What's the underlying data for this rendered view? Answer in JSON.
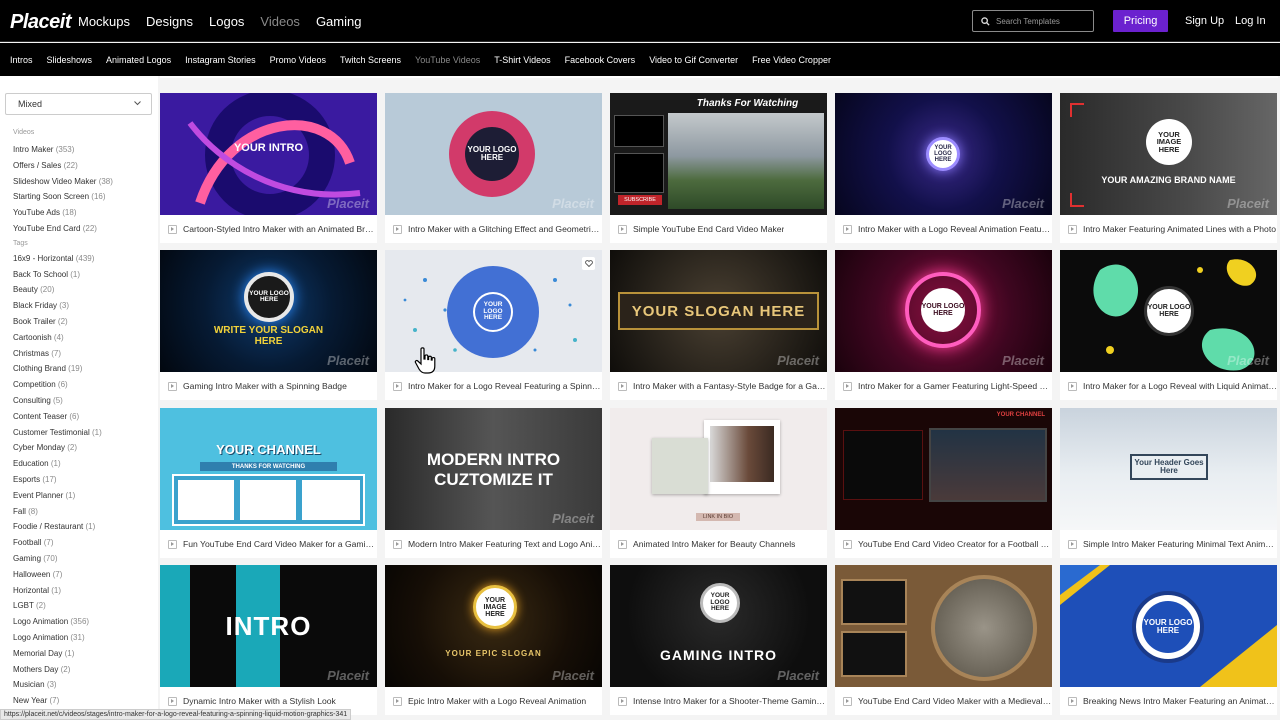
{
  "header": {
    "logo": "Placeit",
    "nav": [
      "Mockups",
      "Designs",
      "Logos",
      "Videos",
      "Gaming"
    ],
    "active_nav": "Videos",
    "search_placeholder": "Search Templates",
    "pricing": "Pricing",
    "sign_up": "Sign Up",
    "log_in": "Log In"
  },
  "subnav": [
    "Intros",
    "Slideshows",
    "Animated Logos",
    "Instagram Stories",
    "Promo Videos",
    "Twitch Screens",
    "YouTube Videos",
    "T-Shirt Videos",
    "Facebook Covers",
    "Video to Gif Converter",
    "Free Video Cropper"
  ],
  "active_subnav": "YouTube Videos",
  "sidebar": {
    "sort": "Mixed",
    "videos_heading": "Videos",
    "videos": [
      {
        "label": "Intro Maker",
        "count": "(353)"
      },
      {
        "label": "Offers / Sales",
        "count": "(22)"
      },
      {
        "label": "Slideshow Video Maker",
        "count": "(38)"
      },
      {
        "label": "Starting Soon Screen",
        "count": "(16)"
      },
      {
        "label": "YouTube Ads",
        "count": "(18)"
      },
      {
        "label": "YouTube End Card",
        "count": "(22)"
      }
    ],
    "tags_heading": "Tags",
    "tags": [
      {
        "label": "16x9 - Horizontal",
        "count": "(439)"
      },
      {
        "label": "Back To School",
        "count": "(1)"
      },
      {
        "label": "Beauty",
        "count": "(20)"
      },
      {
        "label": "Black Friday",
        "count": "(3)"
      },
      {
        "label": "Book Trailer",
        "count": "(2)"
      },
      {
        "label": "Cartoonish",
        "count": "(4)"
      },
      {
        "label": "Christmas",
        "count": "(7)"
      },
      {
        "label": "Clothing Brand",
        "count": "(19)"
      },
      {
        "label": "Competition",
        "count": "(6)"
      },
      {
        "label": "Consulting",
        "count": "(5)"
      },
      {
        "label": "Content Teaser",
        "count": "(6)"
      },
      {
        "label": "Customer Testimonial",
        "count": "(1)"
      },
      {
        "label": "Cyber Monday",
        "count": "(2)"
      },
      {
        "label": "Education",
        "count": "(1)"
      },
      {
        "label": "Esports",
        "count": "(17)"
      },
      {
        "label": "Event Planner",
        "count": "(1)"
      },
      {
        "label": "Fall",
        "count": "(8)"
      },
      {
        "label": "Foodie / Restaurant",
        "count": "(1)"
      },
      {
        "label": "Football",
        "count": "(7)"
      },
      {
        "label": "Gaming",
        "count": "(70)"
      },
      {
        "label": "Halloween",
        "count": "(7)"
      },
      {
        "label": "Horizontal",
        "count": "(1)"
      },
      {
        "label": "LGBT",
        "count": "(2)"
      },
      {
        "label": "Logo Animation",
        "count": "(356)"
      },
      {
        "label": "Logo Animation",
        "count": "(31)"
      },
      {
        "label": "Memorial Day",
        "count": "(1)"
      },
      {
        "label": "Mothers Day",
        "count": "(2)"
      },
      {
        "label": "Musician",
        "count": "(3)"
      },
      {
        "label": "New Year",
        "count": "(7)"
      }
    ]
  },
  "thumb_text": {
    "your_intro": "YOUR INTRO",
    "your_logo_here": "YOUR LOGO HERE",
    "your_image_here": "YOUR IMAGE HERE",
    "thanks_for_watching": "Thanks For Watching",
    "subscribe": "SUBSCRIBE",
    "brand_name": "YOUR AMAZING BRAND NAME",
    "write_slogan": "WRITE YOUR SLOGAN HERE",
    "slogan_here": "YOUR SLOGAN HERE",
    "your_channel": "YOUR CHANNEL",
    "thanks_watching_caps": "THANKS FOR WATCHING",
    "modern_intro": "MODERN INTRO",
    "cuztomize": "CUZTOMIZE IT",
    "link_in_bio": "LINK IN BIO",
    "header_goes_here": "Your Header Goes Here",
    "intro": "INTRO",
    "epic_slogan": "YOUR EPIC SLOGAN",
    "gaming_intro": "GAMING INTRO",
    "watermark": "Placeit"
  },
  "cards": [
    "Cartoon-Styled Intro Maker with an Animated Brush Stroke",
    "Intro Maker with a Glitching Effect and Geometric Shapes",
    "Simple YouTube End Card Video Maker",
    "Intro Maker with a Logo Reveal Animation Featuring Lights",
    "Intro Maker Featuring Animated Lines with a Photo",
    "Gaming Intro Maker with a Spinning Badge",
    "Intro Maker for a Logo Reveal Featuring a Spinning Liquid Motion",
    "Intro Maker with a Fantasy-Style Badge for a Gaming Channel",
    "Intro Maker for a Gamer Featuring Light-Speed Effects",
    "Intro Maker for a Logo Reveal with Liquid Animations",
    "Fun YouTube End Card Video Maker for a Gaming Channel",
    "Modern Intro Maker Featuring Text and Logo Animation",
    "Animated Intro Maker for Beauty Channels",
    "YouTube End Card Video Creator for a Football Channel",
    "Simple Intro Maker Featuring Minimal Text Animation",
    "Dynamic Intro Maker with a Stylish Look",
    "Epic Intro Maker with a Logo Reveal Animation",
    "Intense Intro Maker for a Shooter-Theme Gaming Channel",
    "YouTube End Card Video Maker with a Medieval Theme",
    "Breaking News Intro Maker Featuring an Animated Logo"
  ],
  "status_url": "https://placeit.net/c/videos/stages/intro-maker-for-a-logo-reveal-featuring-a-spinning-liquid-motion-graphics-341",
  "colors": {
    "accent": "#6b21cf",
    "topbar": "#000000"
  }
}
